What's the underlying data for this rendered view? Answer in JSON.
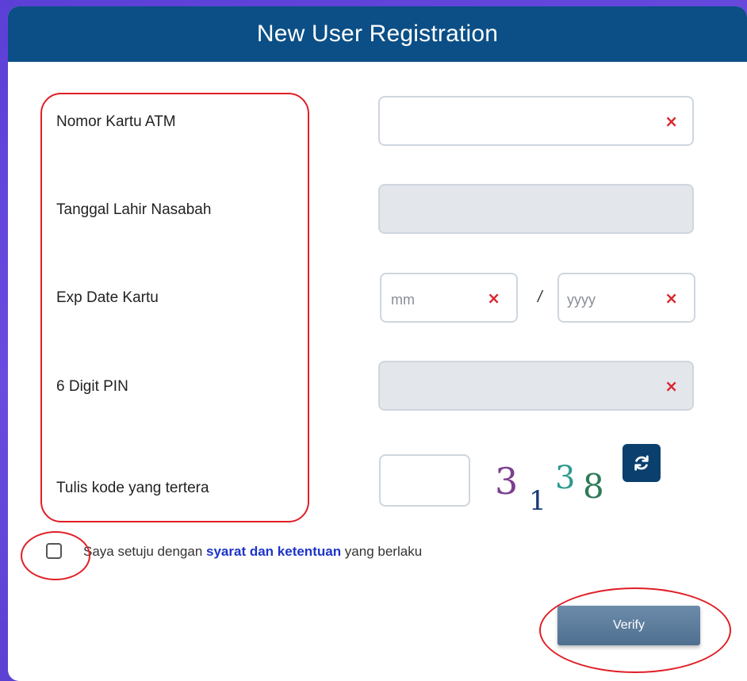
{
  "header": {
    "title": "New User Registration"
  },
  "form": {
    "atm_label": "Nomor Kartu ATM",
    "atm_value": "",
    "dob_label": "Tanggal Lahir Nasabah",
    "dob_value": "",
    "exp_label": "Exp Date Kartu",
    "exp_month_placeholder": "mm",
    "exp_separator": "/",
    "exp_year_placeholder": "yyyy",
    "pin_label": "6 Digit PIN",
    "pin_value": "",
    "captcha_label": "Tulis kode yang tertera",
    "captcha_value": "",
    "captcha_digits": [
      "3",
      "1",
      "3",
      "8"
    ],
    "clear_glyph": "×"
  },
  "terms": {
    "checked": false,
    "prefix": "Saya setuju dengan ",
    "link": "syarat dan ketentuan",
    "suffix": " yang berlaku"
  },
  "actions": {
    "verify_label": "Verify"
  },
  "icons": {
    "clear": "close-icon",
    "refresh": "refresh-icon"
  },
  "colors": {
    "header_bg": "#0b4f86",
    "clear_x": "#d8262c",
    "link": "#1e34c9",
    "annotation": "#e01f26",
    "captcha_3": "#7a3f8f",
    "captcha_1": "#1b3a7a",
    "captcha_3b": "#2e9a8e",
    "captcha_8": "#2f7a5a"
  }
}
